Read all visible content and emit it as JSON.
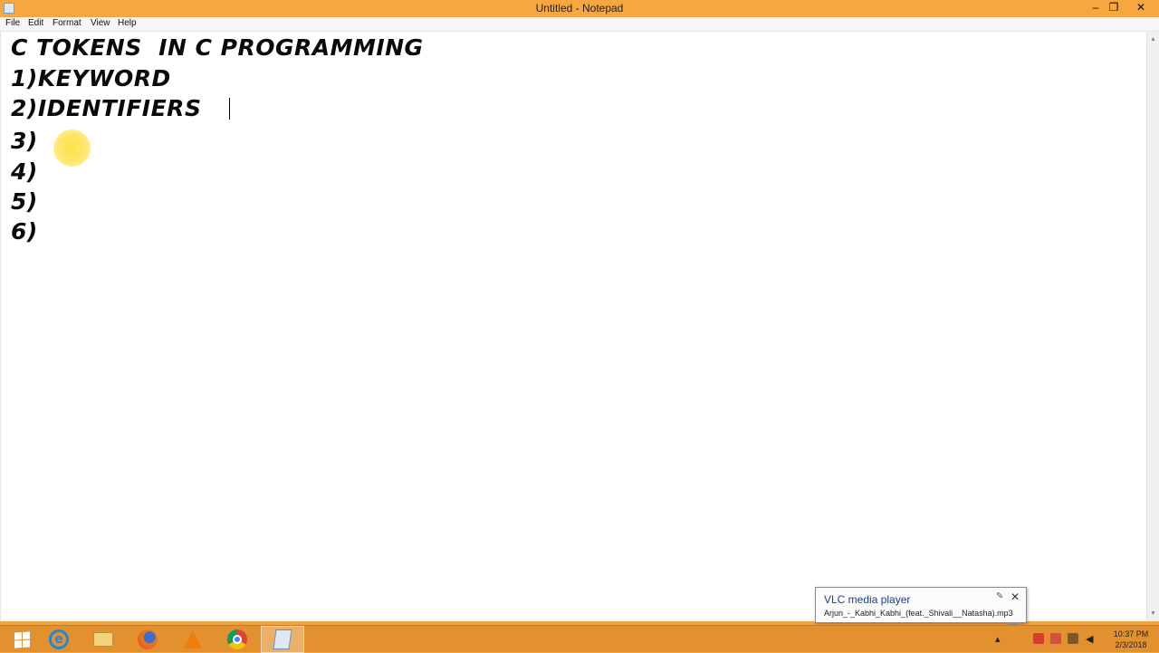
{
  "window": {
    "title": "Untitled - Notepad",
    "minimize_glyph": "–",
    "maximize_glyph": "❐",
    "close_glyph": "✕"
  },
  "menu": {
    "items": [
      "File",
      "Edit",
      "Format",
      "View",
      "Help"
    ]
  },
  "editor": {
    "lines": [
      "C TOKENS  IN C PROGRAMMING",
      "1)KEYWORD",
      "2)IDENTIFIERS",
      "3)",
      "4)",
      "5)",
      "6)"
    ]
  },
  "vlc_notification": {
    "title": "VLC media player",
    "track": "Arjun_-_Kabhi_Kabhi_(feat._Shivali__Natasha).mp3",
    "close_glyph": "✕",
    "pin_glyph": "✎"
  },
  "taskbar": {
    "icons": [
      "windows-start-icon",
      "internet-explorer-icon",
      "file-explorer-icon",
      "firefox-icon",
      "vlc-icon",
      "chrome-icon",
      "notepad-icon"
    ],
    "active": "notepad-icon",
    "clock_time": "10:37 PM",
    "clock_date": "2/3/2018",
    "tray_glyphs": {
      "show_hidden": "▴",
      "volume": "◀"
    }
  },
  "colors": {
    "accent": "#f6a73d",
    "taskbar": "#e2912e",
    "editor_bg": "#ffffff",
    "cursor_highlight": "#ffe13c"
  }
}
